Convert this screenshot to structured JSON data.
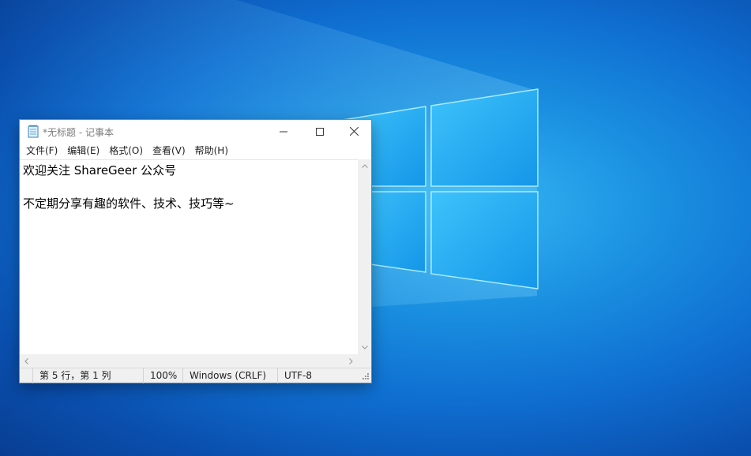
{
  "window": {
    "title": "*无标题 - 记事本",
    "app_icon": "notepad-icon"
  },
  "titlebar_buttons": {
    "minimize": "minimize-icon",
    "maximize": "maximize-icon",
    "close": "close-icon"
  },
  "menu": [
    {
      "label": "文件(F)"
    },
    {
      "label": "编辑(E)"
    },
    {
      "label": "格式(O)"
    },
    {
      "label": "查看(V)"
    },
    {
      "label": "帮助(H)"
    }
  ],
  "editor": {
    "lines": [
      "欢迎关注 ShareGeer 公众号",
      "",
      "不定期分享有趣的软件、技术、技巧等~"
    ]
  },
  "statusbar": {
    "position": "第 5 行，第 1 列",
    "zoom": "100%",
    "line_ending": "Windows (CRLF)",
    "encoding": "UTF-8"
  },
  "colors": {
    "desktop_accent": "#1a8fe0",
    "window_border": "#6d8fb0"
  }
}
